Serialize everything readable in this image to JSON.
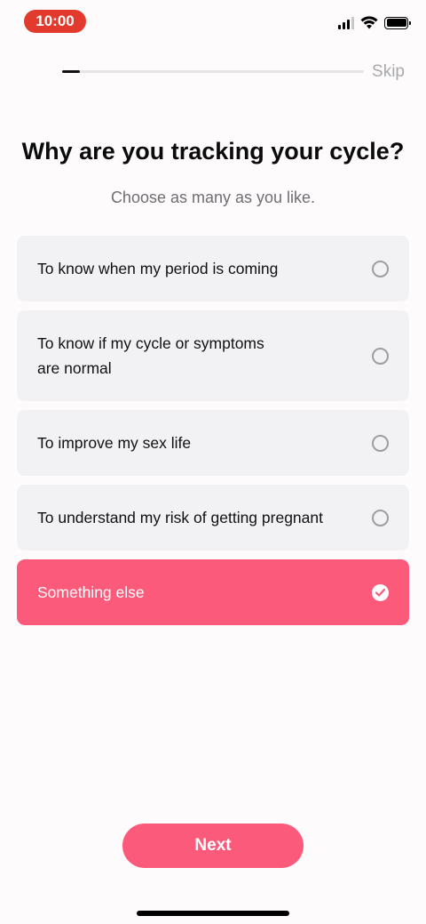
{
  "status_bar": {
    "time": "10:00",
    "icons": [
      "cellular-signal-icon",
      "wifi-icon",
      "battery-icon"
    ]
  },
  "header": {
    "progress": 0.06,
    "skip_label": "Skip"
  },
  "question": {
    "title": "Why are you tracking your cycle?",
    "subtitle": "Choose as many as you like."
  },
  "options": [
    {
      "label": "To know when my period is coming",
      "selected": false
    },
    {
      "label_line1": "To know if my cycle or symptoms",
      "label_line2": "are normal",
      "selected": false
    },
    {
      "label": "To improve my sex life",
      "selected": false
    },
    {
      "label": "To understand my risk of getting pregnant",
      "selected": false
    },
    {
      "label": "Something else",
      "selected": true
    }
  ],
  "footer": {
    "next_label": "Next"
  },
  "colors": {
    "accent": "#fb5a7b",
    "status_time_bg": "#e23b2e",
    "option_bg": "#f2f1f4",
    "background": "#fdfbfc"
  }
}
